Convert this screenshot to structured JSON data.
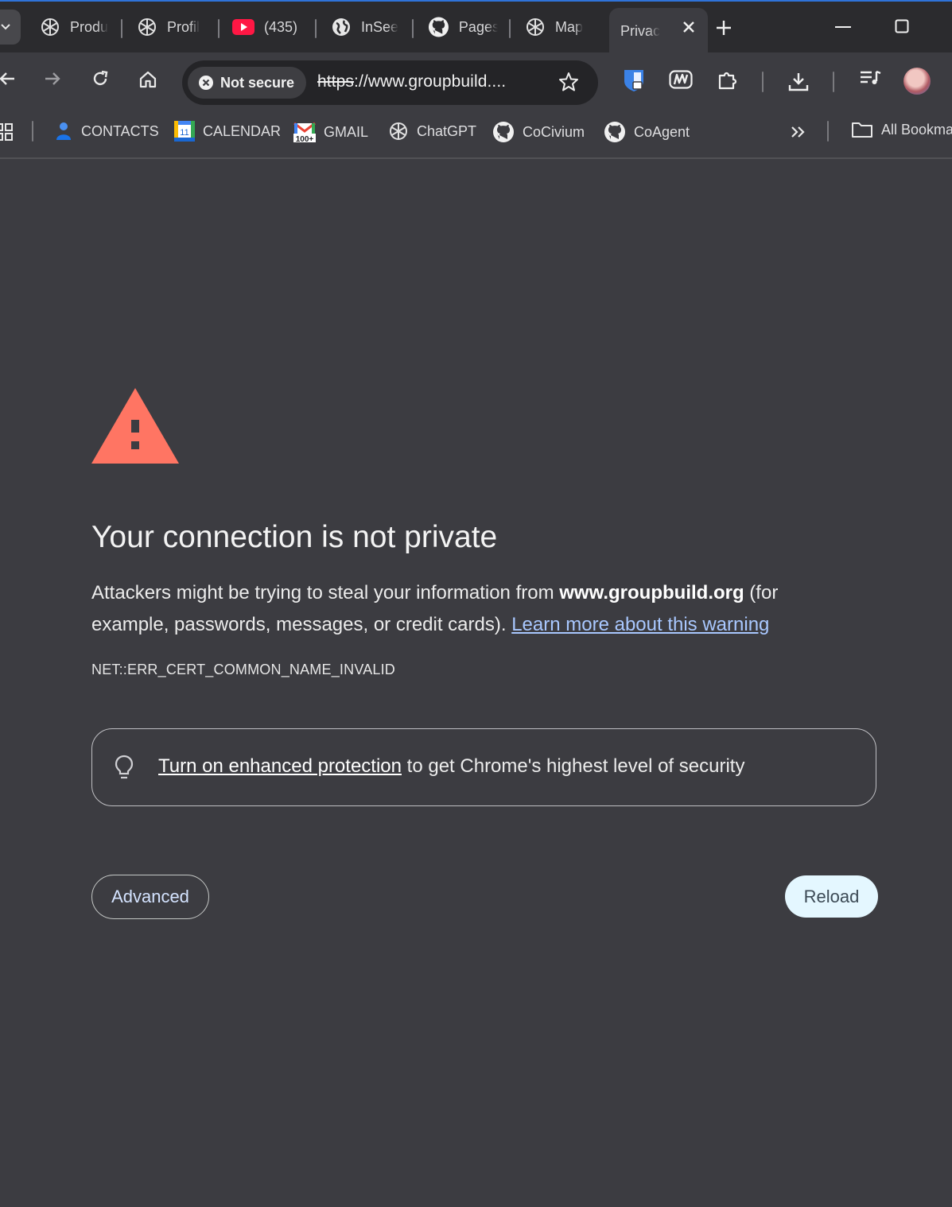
{
  "tabs": [
    {
      "label": "Produ",
      "icon": "chatgpt-icon"
    },
    {
      "label": "Profil",
      "icon": "chatgpt-icon"
    },
    {
      "label": "(435)",
      "icon": "youtube-icon"
    },
    {
      "label": "InSee",
      "icon": "globe-icon"
    },
    {
      "label": "Pages",
      "icon": "github-icon"
    },
    {
      "label": "Map",
      "icon": "chatgpt-icon"
    },
    {
      "label": "Privac",
      "icon": "none",
      "active": true
    }
  ],
  "omnibox": {
    "security_chip": "Not secure",
    "url_scheme": "https",
    "url_rest": "://www.groupbuild...."
  },
  "bookmarks": [
    {
      "label": "CONTACTS",
      "icon": "contacts-icon"
    },
    {
      "label": "CALENDAR",
      "icon": "calendar-icon",
      "badge": "11"
    },
    {
      "label": "GMAIL",
      "icon": "gmail-icon",
      "badge": "100+"
    },
    {
      "label": "ChatGPT",
      "icon": "chatgpt-icon"
    },
    {
      "label": "CoCivium",
      "icon": "github-icon"
    },
    {
      "label": "CoAgent",
      "icon": "github-icon"
    }
  ],
  "all_bookmarks": "All Bookma",
  "page": {
    "heading": "Your connection is not private",
    "para_prefix": "Attackers might be trying to steal your information from ",
    "domain": "www.groupbuild.org",
    "para_suffix": " (for example, passwords, messages, or credit cards). ",
    "learn_more": "Learn more about this warning",
    "error_code": "NET::ERR_CERT_COMMON_NAME_INVALID",
    "promo_link": "Turn on enhanced protection",
    "promo_text": " to get Chrome's highest level of security",
    "advanced_button": "Advanced",
    "reload_button": "Reload"
  },
  "colors": {
    "background": "#3c3c41",
    "warning": "#ff7563",
    "link": "#a9c8ff",
    "reload_bg": "#e4f7ff",
    "tab_strip": "#2b2b2e"
  }
}
